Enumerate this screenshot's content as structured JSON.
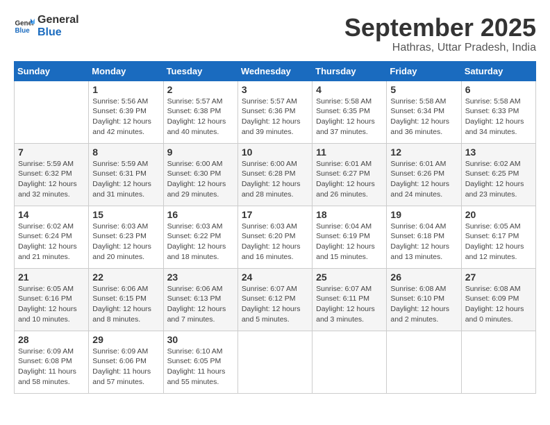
{
  "header": {
    "logo_general": "General",
    "logo_blue": "Blue",
    "month_title": "September 2025",
    "subtitle": "Hathras, Uttar Pradesh, India"
  },
  "days_of_week": [
    "Sunday",
    "Monday",
    "Tuesday",
    "Wednesday",
    "Thursday",
    "Friday",
    "Saturday"
  ],
  "weeks": [
    [
      {
        "day": "",
        "info": ""
      },
      {
        "day": "1",
        "info": "Sunrise: 5:56 AM\nSunset: 6:39 PM\nDaylight: 12 hours\nand 42 minutes."
      },
      {
        "day": "2",
        "info": "Sunrise: 5:57 AM\nSunset: 6:38 PM\nDaylight: 12 hours\nand 40 minutes."
      },
      {
        "day": "3",
        "info": "Sunrise: 5:57 AM\nSunset: 6:36 PM\nDaylight: 12 hours\nand 39 minutes."
      },
      {
        "day": "4",
        "info": "Sunrise: 5:58 AM\nSunset: 6:35 PM\nDaylight: 12 hours\nand 37 minutes."
      },
      {
        "day": "5",
        "info": "Sunrise: 5:58 AM\nSunset: 6:34 PM\nDaylight: 12 hours\nand 36 minutes."
      },
      {
        "day": "6",
        "info": "Sunrise: 5:58 AM\nSunset: 6:33 PM\nDaylight: 12 hours\nand 34 minutes."
      }
    ],
    [
      {
        "day": "7",
        "info": "Sunrise: 5:59 AM\nSunset: 6:32 PM\nDaylight: 12 hours\nand 32 minutes."
      },
      {
        "day": "8",
        "info": "Sunrise: 5:59 AM\nSunset: 6:31 PM\nDaylight: 12 hours\nand 31 minutes."
      },
      {
        "day": "9",
        "info": "Sunrise: 6:00 AM\nSunset: 6:30 PM\nDaylight: 12 hours\nand 29 minutes."
      },
      {
        "day": "10",
        "info": "Sunrise: 6:00 AM\nSunset: 6:28 PM\nDaylight: 12 hours\nand 28 minutes."
      },
      {
        "day": "11",
        "info": "Sunrise: 6:01 AM\nSunset: 6:27 PM\nDaylight: 12 hours\nand 26 minutes."
      },
      {
        "day": "12",
        "info": "Sunrise: 6:01 AM\nSunset: 6:26 PM\nDaylight: 12 hours\nand 24 minutes."
      },
      {
        "day": "13",
        "info": "Sunrise: 6:02 AM\nSunset: 6:25 PM\nDaylight: 12 hours\nand 23 minutes."
      }
    ],
    [
      {
        "day": "14",
        "info": "Sunrise: 6:02 AM\nSunset: 6:24 PM\nDaylight: 12 hours\nand 21 minutes."
      },
      {
        "day": "15",
        "info": "Sunrise: 6:03 AM\nSunset: 6:23 PM\nDaylight: 12 hours\nand 20 minutes."
      },
      {
        "day": "16",
        "info": "Sunrise: 6:03 AM\nSunset: 6:22 PM\nDaylight: 12 hours\nand 18 minutes."
      },
      {
        "day": "17",
        "info": "Sunrise: 6:03 AM\nSunset: 6:20 PM\nDaylight: 12 hours\nand 16 minutes."
      },
      {
        "day": "18",
        "info": "Sunrise: 6:04 AM\nSunset: 6:19 PM\nDaylight: 12 hours\nand 15 minutes."
      },
      {
        "day": "19",
        "info": "Sunrise: 6:04 AM\nSunset: 6:18 PM\nDaylight: 12 hours\nand 13 minutes."
      },
      {
        "day": "20",
        "info": "Sunrise: 6:05 AM\nSunset: 6:17 PM\nDaylight: 12 hours\nand 12 minutes."
      }
    ],
    [
      {
        "day": "21",
        "info": "Sunrise: 6:05 AM\nSunset: 6:16 PM\nDaylight: 12 hours\nand 10 minutes."
      },
      {
        "day": "22",
        "info": "Sunrise: 6:06 AM\nSunset: 6:15 PM\nDaylight: 12 hours\nand 8 minutes."
      },
      {
        "day": "23",
        "info": "Sunrise: 6:06 AM\nSunset: 6:13 PM\nDaylight: 12 hours\nand 7 minutes."
      },
      {
        "day": "24",
        "info": "Sunrise: 6:07 AM\nSunset: 6:12 PM\nDaylight: 12 hours\nand 5 minutes."
      },
      {
        "day": "25",
        "info": "Sunrise: 6:07 AM\nSunset: 6:11 PM\nDaylight: 12 hours\nand 3 minutes."
      },
      {
        "day": "26",
        "info": "Sunrise: 6:08 AM\nSunset: 6:10 PM\nDaylight: 12 hours\nand 2 minutes."
      },
      {
        "day": "27",
        "info": "Sunrise: 6:08 AM\nSunset: 6:09 PM\nDaylight: 12 hours\nand 0 minutes."
      }
    ],
    [
      {
        "day": "28",
        "info": "Sunrise: 6:09 AM\nSunset: 6:08 PM\nDaylight: 11 hours\nand 58 minutes."
      },
      {
        "day": "29",
        "info": "Sunrise: 6:09 AM\nSunset: 6:06 PM\nDaylight: 11 hours\nand 57 minutes."
      },
      {
        "day": "30",
        "info": "Sunrise: 6:10 AM\nSunset: 6:05 PM\nDaylight: 11 hours\nand 55 minutes."
      },
      {
        "day": "",
        "info": ""
      },
      {
        "day": "",
        "info": ""
      },
      {
        "day": "",
        "info": ""
      },
      {
        "day": "",
        "info": ""
      }
    ]
  ]
}
